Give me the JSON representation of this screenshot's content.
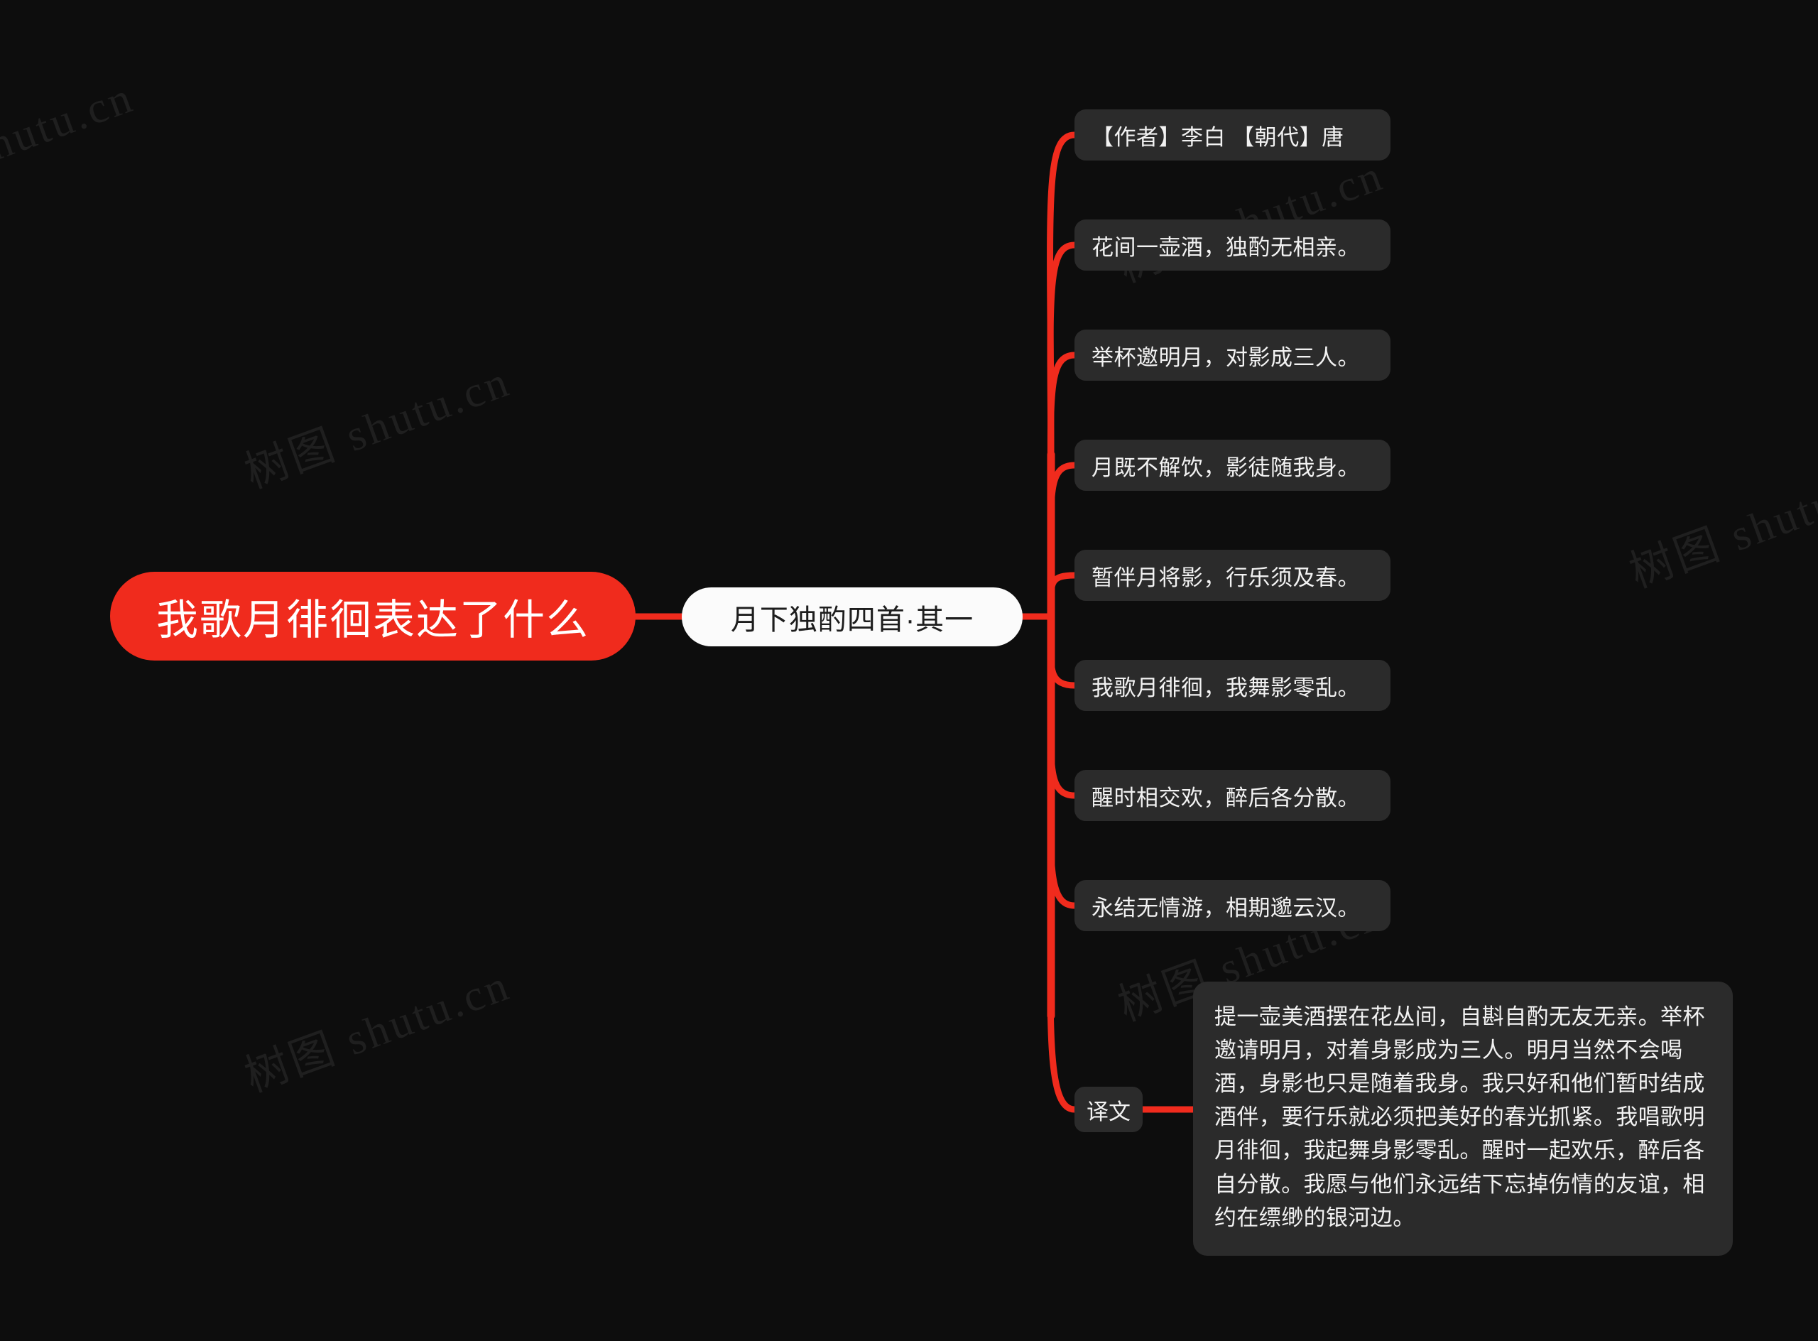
{
  "canvas": {
    "background_color": "#0d0d0d",
    "accent_color": "#f02b1d",
    "node_color": "#2b2b2b",
    "center_node_color": "#fbfbfb"
  },
  "watermark": {
    "text": "树图 shutu.cn"
  },
  "mindmap": {
    "root": {
      "label": "我歌月徘徊表达了什么"
    },
    "center": {
      "label": "月下独酌四首·其一"
    },
    "leaves": [
      {
        "label": "【作者】李白  【朝代】唐"
      },
      {
        "label": "花间一壶酒，独酌无相亲。"
      },
      {
        "label": "举杯邀明月，对影成三人。"
      },
      {
        "label": "月既不解饮，影徒随我身。"
      },
      {
        "label": "暂伴月将影，行乐须及春。"
      },
      {
        "label": "我歌月徘徊，我舞影零乱。"
      },
      {
        "label": "醒时相交欢，醉后各分散。"
      },
      {
        "label": "永结无情游，相期邈云汉。"
      }
    ],
    "translation": {
      "label": "译文",
      "body": "提一壶美酒摆在花丛间，自斟自酌无友无亲。举杯邀请明月，对着身影成为三人。明月当然不会喝酒，身影也只是随着我身。我只好和他们暂时结成酒伴，要行乐就必须把美好的春光抓紧。我唱歌明月徘徊，我起舞身影零乱。醒时一起欢乐，醉后各自分散。我愿与他们永远结下忘掉伤情的友谊，相约在缥缈的银河边。"
    }
  }
}
